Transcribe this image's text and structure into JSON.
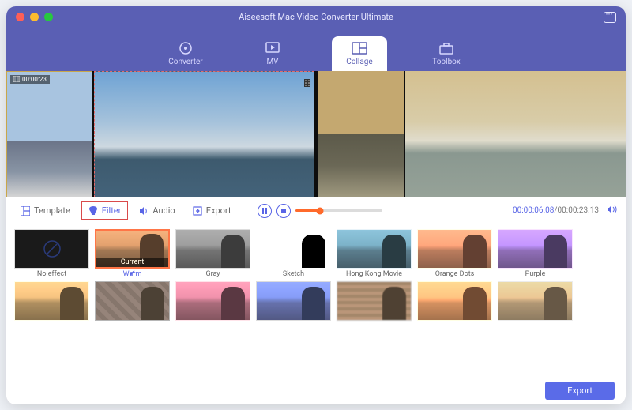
{
  "app": {
    "title": "Aiseesoft Mac Video Converter Ultimate"
  },
  "main_tabs": {
    "converter": "Converter",
    "mv": "MV",
    "collage": "Collage",
    "toolbox": "Toolbox",
    "active": "collage"
  },
  "preview": {
    "left_clip_timestamp": "00:00:23"
  },
  "tool_tabs": {
    "template": "Template",
    "filter": "Filter",
    "audio": "Audio",
    "export": "Export",
    "active": "filter"
  },
  "playback": {
    "current": "00:00:06.08",
    "total": "00:00:23.13",
    "progress_pct": 28
  },
  "filters": {
    "row1": [
      {
        "id": "noeffect",
        "label": "No effect"
      },
      {
        "id": "warm",
        "label": "Warm",
        "selected": true,
        "current_badge": "Current"
      },
      {
        "id": "gray",
        "label": "Gray"
      },
      {
        "id": "sketch",
        "label": "Sketch"
      },
      {
        "id": "hkmovie",
        "label": "Hong Kong Movie"
      },
      {
        "id": "orangedots",
        "label": "Orange Dots"
      },
      {
        "id": "purple",
        "label": "Purple"
      }
    ]
  },
  "export_button": "Export",
  "colors": {
    "accent": "#5a5fb4",
    "primary_blue": "#5965e6",
    "orange": "#ff6a2b",
    "selection_red": "#d94a4a"
  }
}
